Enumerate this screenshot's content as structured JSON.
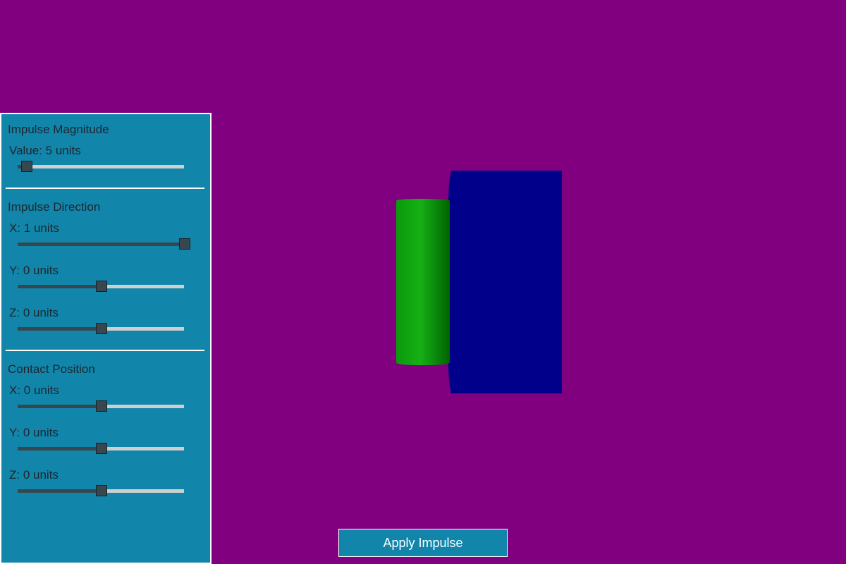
{
  "colors": {
    "background": "#800080",
    "panel": "#1186aa",
    "panel_border": "#ffffff",
    "text": "#1e2630",
    "track_empty": "#cfcfcf",
    "track_fill": "#37474f",
    "thumb": "#37474f",
    "button": "#1186aa",
    "button_text": "#ffffff",
    "box": "#00008b",
    "cylinder_light": "#10b010",
    "cylinder_dark": "#006400"
  },
  "panel": {
    "magnitude": {
      "title": "Impulse Magnitude",
      "label": "Value: 5 units",
      "value": 5,
      "min": 0,
      "max": 100
    },
    "direction": {
      "title": "Impulse Direction",
      "x": {
        "label": "X: 1 units",
        "value": 1,
        "min": -1,
        "max": 1
      },
      "y": {
        "label": "Y: 0 units",
        "value": 0,
        "min": -1,
        "max": 1
      },
      "z": {
        "label": "Z: 0 units",
        "value": 0,
        "min": -1,
        "max": 1
      }
    },
    "contact": {
      "title": "Contact Position",
      "x": {
        "label": "X: 0 units",
        "value": 0,
        "min": -1,
        "max": 1
      },
      "y": {
        "label": "Y: 0 units",
        "value": 0,
        "min": -1,
        "max": 1
      },
      "z": {
        "label": "Z: 0 units",
        "value": 0,
        "min": -1,
        "max": 1
      }
    }
  },
  "apply_button": {
    "label": "Apply Impulse"
  },
  "scene": {
    "objects": [
      {
        "name": "blue box",
        "shape": "box",
        "color": "#00008b"
      },
      {
        "name": "green cylinder",
        "shape": "cylinder",
        "color": "#10b010"
      }
    ]
  }
}
